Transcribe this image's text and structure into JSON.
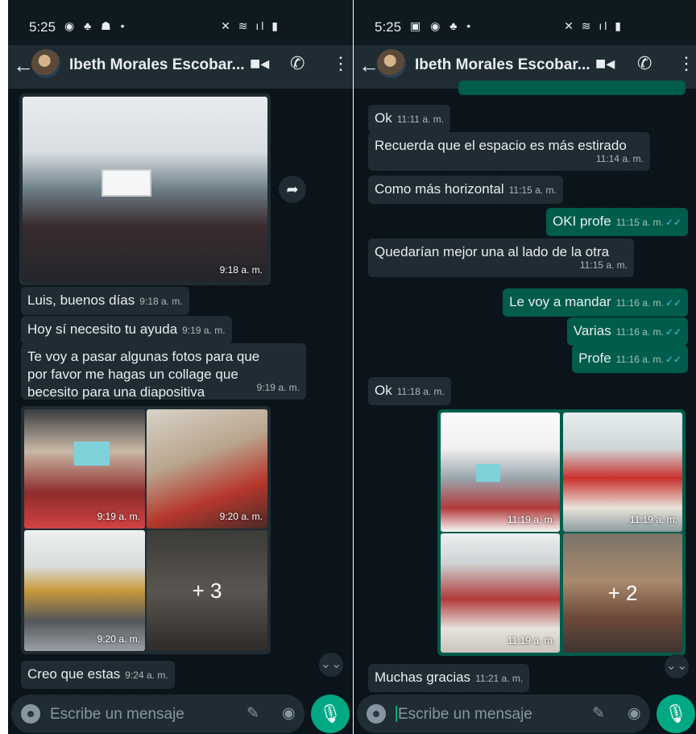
{
  "colors": {
    "chat_bg": "#0b141a",
    "incoming": "#1f2c33",
    "outgoing": "#005c4b",
    "accent": "#00a884",
    "read_ticks": "#53bdeb"
  },
  "left": {
    "status": {
      "time": "5:25",
      "icons": "◉ ♣ ☗ •",
      "right_icons": "✕ ≋ ıl ▮"
    },
    "header": {
      "contact": "Ibeth Morales Escobar...",
      "back_icon": "←",
      "video_icon": "■◂",
      "call_icon": "✆",
      "menu_icon": "⋮"
    },
    "messages": [
      {
        "time": "9:18 a. m."
      },
      {
        "text": "Luis, buenos días",
        "time": "9:18 a. m."
      },
      {
        "text": "Hoy sí necesito tu ayuda",
        "time": "9:19 a. m."
      },
      {
        "line1": "Te voy a pasar algunas fotos para que",
        "line2": "por favor me hagas un collage que",
        "line3": "becesito para una diapositiva",
        "time": "9:19 a. m."
      },
      {
        "t1": "9:19 a. m.",
        "t2": "9:20 a. m.",
        "t3": "9:20 a. m.",
        "more": "+ 3"
      },
      {
        "text": "Creo que estas",
        "time": "9:24 a. m."
      }
    ],
    "forward_icon": "➦",
    "scroll_icon": "⌄⌄",
    "input": {
      "placeholder": "Escribe un mensaje",
      "emoji_icon": "☻",
      "clip_icon": "✎",
      "camera_icon": "◉",
      "mic_icon": "🎙"
    }
  },
  "right": {
    "status": {
      "time": "5:25",
      "icons": "▣ ◉ ♣ •",
      "right_icons": "✕ ≋ ıl ▮"
    },
    "header": {
      "contact": "Ibeth Morales Escobar...",
      "back_icon": "←",
      "video_icon": "■◂",
      "call_icon": "✆",
      "menu_icon": "⋮"
    },
    "messages": [
      {
        "text": "Ok",
        "time": "11:11 a. m."
      },
      {
        "text": "Recuerda que el espacio es más estirado",
        "time": "11:14 a. m."
      },
      {
        "text": "Como más horizontal",
        "time": "11:15 a. m."
      },
      {
        "text": "OKI profe",
        "time": "11:15 a. m."
      },
      {
        "text": "Quedarían mejor una al lado de la otra",
        "time": "11:15 a. m."
      },
      {
        "text": "Le voy a mandar",
        "time": "11:16 a. m."
      },
      {
        "text": "Varias",
        "time": "11:16 a. m."
      },
      {
        "text": "Profe",
        "time": "11:16 a. m."
      },
      {
        "text": "Ok",
        "time": "11:18 a. m."
      },
      {
        "t1": "11:19 a. m.",
        "t2": "11:19 a. m.",
        "t3": "11:19 a. m.",
        "more": "+ 2"
      },
      {
        "text": "Muchas gracias",
        "time": "11:21 a. m."
      }
    ],
    "ticks": "✓✓",
    "scroll_icon": "⌄⌄",
    "input": {
      "placeholder": "Escribe un mensaje",
      "emoji_icon": "☻",
      "clip_icon": "✎",
      "camera_icon": "◉",
      "mic_icon": "🎙"
    }
  }
}
